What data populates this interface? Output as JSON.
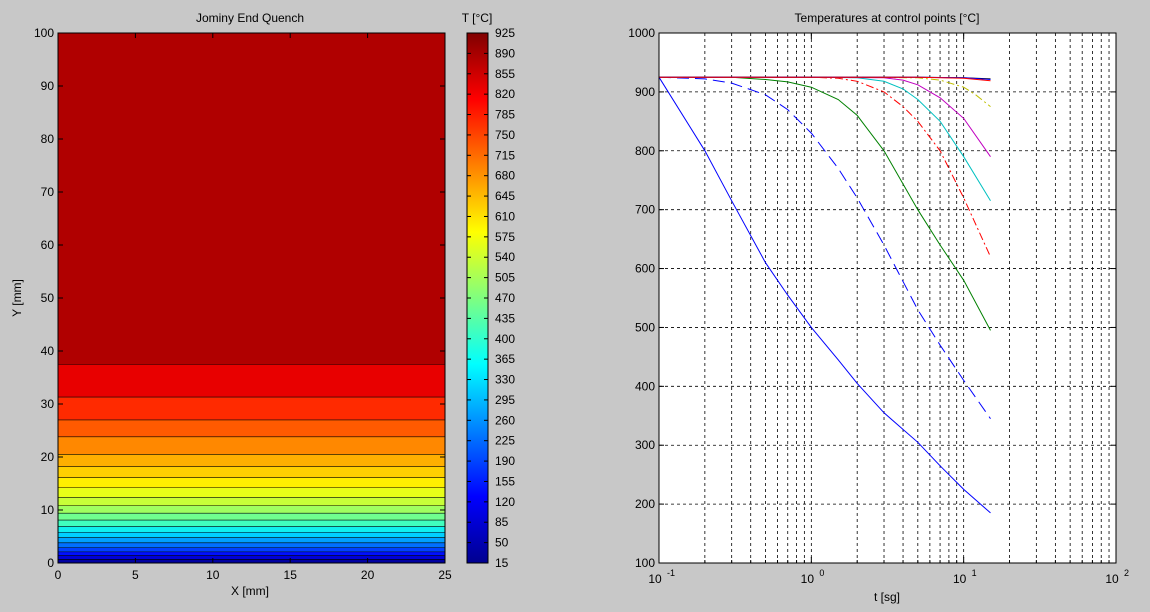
{
  "chart_data": [
    {
      "type": "heatmap",
      "title": "Jominy End Quench",
      "xlabel": "X [mm]",
      "ylabel": "Y [mm]",
      "xlim": [
        0,
        25
      ],
      "ylim": [
        0,
        100
      ],
      "xticks": [
        0,
        5,
        10,
        15,
        20,
        25
      ],
      "yticks": [
        0,
        10,
        20,
        30,
        40,
        50,
        60,
        70,
        80,
        90,
        100
      ],
      "colorbar": {
        "label": "T [°C]",
        "min": 15,
        "max": 925,
        "ticks": [
          15,
          50,
          85,
          120,
          155,
          190,
          225,
          260,
          295,
          330,
          365,
          400,
          435,
          470,
          505,
          540,
          575,
          610,
          645,
          680,
          715,
          750,
          785,
          820,
          855,
          890,
          925
        ]
      },
      "bands": [
        {
          "y0": 0,
          "y1": 0.7,
          "color": "#0000a0"
        },
        {
          "y0": 0.7,
          "y1": 1.4,
          "color": "#0000d8"
        },
        {
          "y0": 1.4,
          "y1": 2.1,
          "color": "#0010ff"
        },
        {
          "y0": 2.1,
          "y1": 2.9,
          "color": "#0040ff"
        },
        {
          "y0": 2.9,
          "y1": 3.8,
          "color": "#0070ff"
        },
        {
          "y0": 3.8,
          "y1": 4.8,
          "color": "#00a0ff"
        },
        {
          "y0": 4.8,
          "y1": 5.8,
          "color": "#00d0ff"
        },
        {
          "y0": 5.8,
          "y1": 6.9,
          "color": "#10f0ef"
        },
        {
          "y0": 6.9,
          "y1": 8.1,
          "color": "#40ffbf"
        },
        {
          "y0": 8.1,
          "y1": 9.4,
          "color": "#70ff8f"
        },
        {
          "y0": 9.4,
          "y1": 10.8,
          "color": "#a0ff60"
        },
        {
          "y0": 10.8,
          "y1": 12.4,
          "color": "#c8ff38"
        },
        {
          "y0": 12.4,
          "y1": 14.2,
          "color": "#e8ff18"
        },
        {
          "y0": 14.2,
          "y1": 16.1,
          "color": "#ffef00"
        },
        {
          "y0": 16.1,
          "y1": 18.2,
          "color": "#ffcf00"
        },
        {
          "y0": 18.2,
          "y1": 20.5,
          "color": "#ffaf00"
        },
        {
          "y0": 20.5,
          "y1": 23.8,
          "color": "#ff8800"
        },
        {
          "y0": 23.8,
          "y1": 27.0,
          "color": "#ff5a00"
        },
        {
          "y0": 27.0,
          "y1": 31.3,
          "color": "#ff2a00"
        },
        {
          "y0": 31.3,
          "y1": 37.5,
          "color": "#e80000"
        },
        {
          "y0": 37.5,
          "y1": 100,
          "color": "#b00000"
        }
      ]
    },
    {
      "type": "line",
      "title": "Temperatures at control points [°C]",
      "xlabel": "t [sg]",
      "ylabel": "",
      "xscale": "log",
      "xlim": [
        0.1,
        100
      ],
      "ylim": [
        100,
        1000
      ],
      "xticks": [
        {
          "base": "10",
          "exp": "-1"
        },
        {
          "base": "10",
          "exp": "0"
        },
        {
          "base": "10",
          "exp": "1"
        },
        {
          "base": "10",
          "exp": "2"
        }
      ],
      "yticks": [
        100,
        200,
        300,
        400,
        500,
        600,
        700,
        800,
        900,
        1000
      ],
      "grid": true,
      "series": [
        {
          "color": "#0000ff",
          "dash": "",
          "x": [
            0.1,
            0.2,
            0.3,
            0.5,
            0.7,
            1,
            1.5,
            2,
            3,
            5,
            7,
            10,
            15
          ],
          "y": [
            925,
            800,
            715,
            610,
            555,
            500,
            445,
            405,
            355,
            305,
            265,
            225,
            185
          ]
        },
        {
          "color": "#0000ff",
          "dash": "12,6",
          "x": [
            0.1,
            0.2,
            0.3,
            0.5,
            0.7,
            1,
            1.5,
            2,
            3,
            5,
            7,
            10,
            15
          ],
          "y": [
            925,
            922,
            915,
            895,
            870,
            830,
            770,
            720,
            640,
            530,
            470,
            410,
            345
          ]
        },
        {
          "color": "#008000",
          "dash": "",
          "x": [
            0.1,
            0.3,
            0.5,
            0.7,
            1,
            1.5,
            2,
            3,
            5,
            7,
            10,
            15
          ],
          "y": [
            925,
            925,
            921,
            917,
            908,
            887,
            860,
            800,
            700,
            640,
            580,
            495
          ]
        },
        {
          "color": "#ff0000",
          "dash": "8,3,2,3",
          "x": [
            0.1,
            0.5,
            1,
            1.5,
            2,
            3,
            4,
            5,
            7,
            10,
            15
          ],
          "y": [
            925,
            925,
            925,
            923,
            918,
            900,
            875,
            850,
            800,
            720,
            620
          ]
        },
        {
          "color": "#00c0c0",
          "dash": "",
          "x": [
            0.1,
            1,
            2,
            3,
            4,
            5,
            7,
            10,
            15
          ],
          "y": [
            925,
            925,
            924,
            918,
            905,
            887,
            850,
            790,
            715
          ]
        },
        {
          "color": "#c000c0",
          "dash": "",
          "x": [
            0.1,
            1,
            3,
            4,
            5,
            7,
            10,
            15
          ],
          "y": [
            925,
            925,
            924,
            920,
            912,
            890,
            855,
            790
          ]
        },
        {
          "color": "#c0c000",
          "dash": "8,3,2,3",
          "x": [
            0.1,
            2,
            5,
            7,
            10,
            12,
            15
          ],
          "y": [
            925,
            925,
            924,
            920,
            908,
            895,
            875
          ]
        },
        {
          "color": "#000000",
          "dash": "",
          "x": [
            0.1,
            5,
            10,
            15
          ],
          "y": [
            925,
            925,
            924,
            922
          ]
        },
        {
          "color": "#0000ff",
          "dash": "",
          "x": [
            0.1,
            5,
            10,
            15
          ],
          "y": [
            925,
            925,
            924,
            921
          ]
        },
        {
          "color": "#ff0000",
          "dash": "",
          "x": [
            0.1,
            5,
            10,
            15
          ],
          "y": [
            925,
            925,
            923,
            919
          ]
        }
      ]
    }
  ]
}
